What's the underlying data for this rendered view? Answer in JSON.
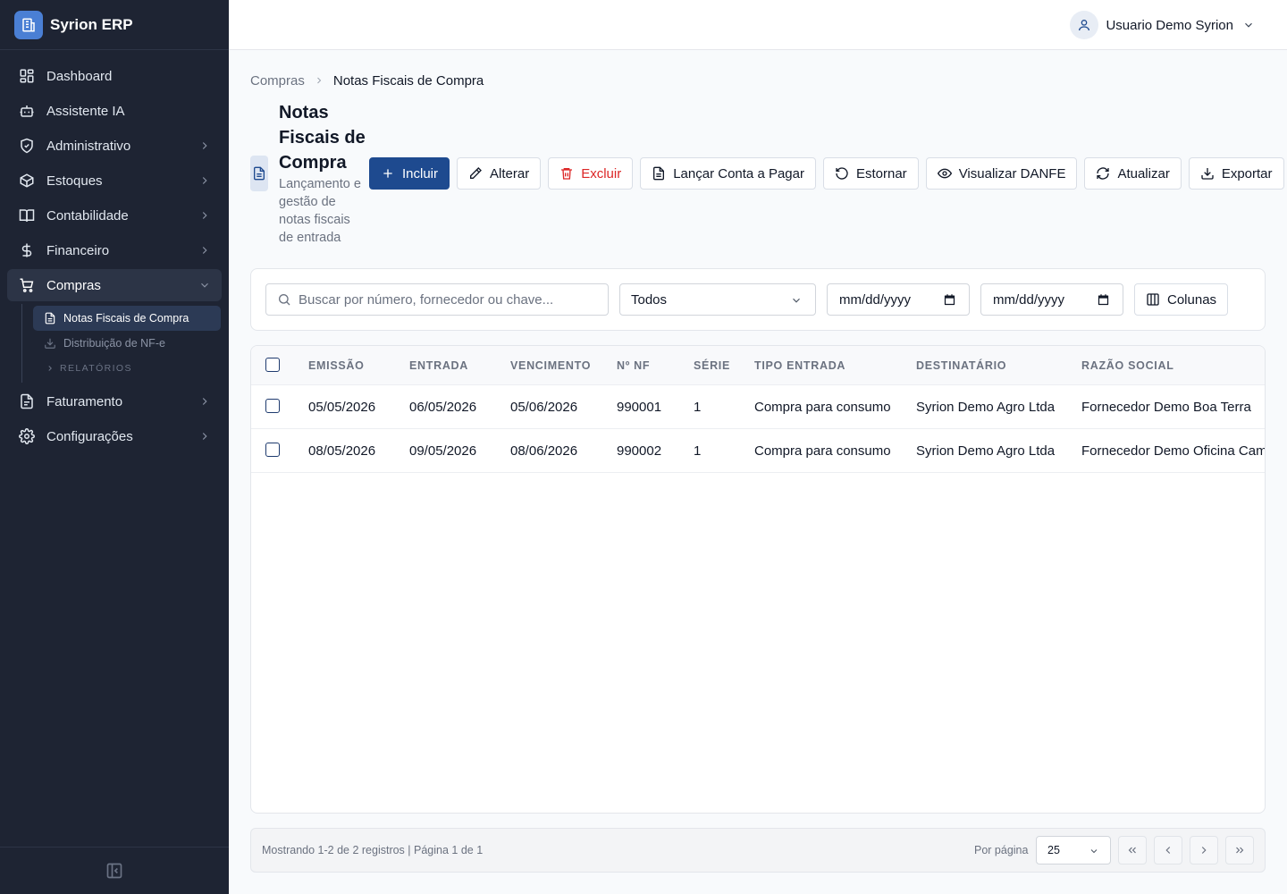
{
  "app": {
    "name": "Syrion ERP"
  },
  "sidebar": {
    "items": [
      {
        "label": "Dashboard",
        "icon": "dashboard-icon"
      },
      {
        "label": "Assistente IA",
        "icon": "bot-icon"
      },
      {
        "label": "Administrativo",
        "icon": "shield-icon"
      },
      {
        "label": "Estoques",
        "icon": "box-icon"
      },
      {
        "label": "Contabilidade",
        "icon": "book-icon"
      },
      {
        "label": "Financeiro",
        "icon": "dollar-icon"
      },
      {
        "label": "Compras",
        "icon": "cart-icon"
      },
      {
        "label": "Faturamento",
        "icon": "file-icon"
      },
      {
        "label": "Configurações",
        "icon": "gear-icon"
      }
    ],
    "subitems": [
      {
        "label": "Notas Fiscais de Compra",
        "active": true
      },
      {
        "label": "Distribuição de NF-e",
        "active": false
      }
    ],
    "section_label": "RELATÓRIOS"
  },
  "topbar": {
    "user_name": "Usuario Demo Syrion"
  },
  "breadcrumb": {
    "parent": "Compras",
    "current": "Notas Fiscais de Compra"
  },
  "page": {
    "title": "Notas Fiscais de Compra",
    "subtitle": "Lançamento e gestão de notas fiscais de entrada"
  },
  "toolbar": {
    "incluir": "Incluir",
    "alterar": "Alterar",
    "excluir": "Excluir",
    "lancar": "Lançar Conta a Pagar",
    "estornar": "Estornar",
    "visualizar": "Visualizar DANFE",
    "atualizar": "Atualizar",
    "exportar": "Exportar"
  },
  "filters": {
    "search_placeholder": "Buscar por número, fornecedor ou chave...",
    "status_value": "Todos",
    "date_from": "mm/dd/yyyy",
    "date_to": "mm/dd/yyyy",
    "columns_label": "Colunas"
  },
  "table": {
    "headers": [
      "EMISSÃO",
      "ENTRADA",
      "VENCIMENTO",
      "Nº NF",
      "SÉRIE",
      "TIPO ENTRADA",
      "DESTINATÁRIO",
      "RAZÃO SOCIAL"
    ],
    "rows": [
      [
        "05/05/2026",
        "06/05/2026",
        "05/06/2026",
        "990001",
        "1",
        "Compra para consumo",
        "Syrion Demo Agro Ltda",
        "Fornecedor Demo Boa Terra"
      ],
      [
        "08/05/2026",
        "09/05/2026",
        "08/06/2026",
        "990002",
        "1",
        "Compra para consumo",
        "Syrion Demo Agro Ltda",
        "Fornecedor Demo Oficina Campo"
      ]
    ]
  },
  "pagination": {
    "info": "Mostrando 1-2 de 2 registros | Página 1 de 1",
    "per_page_label": "Por página",
    "per_page_value": "25"
  },
  "colors": {
    "sidebar_bg": "#1e2433",
    "primary": "#1e4a8f",
    "danger": "#dc2626"
  }
}
